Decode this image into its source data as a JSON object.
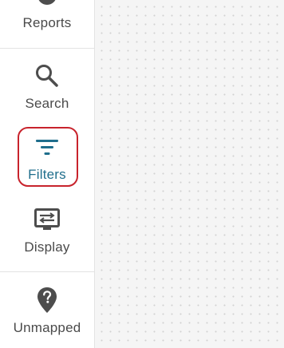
{
  "sidebar": {
    "items": [
      {
        "label": "Reports",
        "icon": "reports-icon"
      },
      {
        "label": "Search",
        "icon": "search-icon"
      },
      {
        "label": "Filters",
        "icon": "filter-icon",
        "active": true
      },
      {
        "label": "Display",
        "icon": "display-icon"
      },
      {
        "label": "Unmapped",
        "icon": "unmapped-location-icon"
      }
    ]
  },
  "colors": {
    "label_text": "#4a4a4a",
    "active_accent": "#1f6e8c",
    "icon": "#4d4d4d",
    "highlight_border": "#c8232c",
    "divider": "#e3e3e3",
    "canvas_background": "#f5f5f5"
  }
}
